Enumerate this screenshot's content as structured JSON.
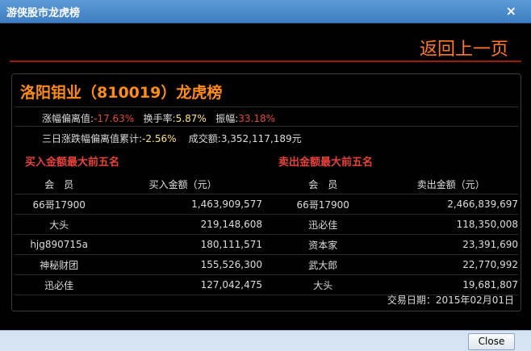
{
  "window": {
    "title": "游侠股市龙虎榜",
    "close_glyph": "×"
  },
  "header": {
    "back_label": "返回上一页"
  },
  "panel": {
    "title": "洛阳钼业（810019）龙虎榜",
    "stats": {
      "deviation_label": "涨幅偏离值:",
      "deviation_value": "-17.63%",
      "turnover_label": "换手率:",
      "turnover_value": "5.87%",
      "amplitude_label": "振幅:",
      "amplitude_value": "33.18%",
      "cum_label": "三日涨跌幅偏离值累计:",
      "cum_value": "-2.56%",
      "volume_label": "成交额:",
      "volume_value": "3,352,117,189元"
    },
    "buy_section_title": "买入金额最大前五名",
    "sell_section_title": "卖出金额最大前五名",
    "columns": {
      "member": "会　员",
      "buy_amount": "买入金额（元）",
      "member2": "会　员",
      "sell_amount": "卖出金额（元）"
    },
    "rows": [
      {
        "buyer": "66哥17900",
        "buy": "1,463,909,577",
        "seller": "66哥17900",
        "sell": "2,466,839,697"
      },
      {
        "buyer": "大头",
        "buy": "219,148,608",
        "seller": "迅必佳",
        "sell": "118,350,008"
      },
      {
        "buyer": "hjg890715a",
        "buy": "180,111,571",
        "seller": "资本家",
        "sell": "23,391,690"
      },
      {
        "buyer": "神秘财团",
        "buy": "155,526,300",
        "seller": "武大郎",
        "sell": "22,770,992"
      },
      {
        "buyer": "迅必佳",
        "buy": "127,042,475",
        "seller": "大头",
        "sell": "19,681,807"
      }
    ],
    "trade_date": "交易日期：2015年02月01日"
  },
  "footer": {
    "close_label": "Close"
  },
  "colors": {
    "accent": "#ff8c1a",
    "negative": "#e04b3a",
    "positive": "#ffe37a",
    "section": "#e8423a"
  }
}
